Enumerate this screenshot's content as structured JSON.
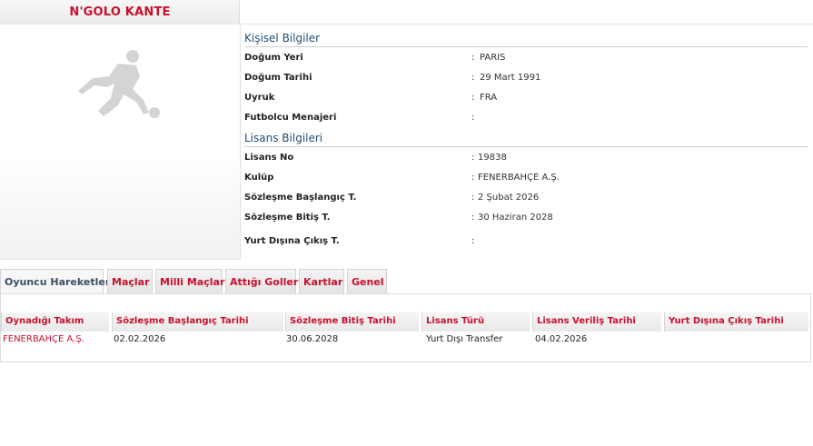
{
  "player": {
    "name": "N'GOLO KANTE"
  },
  "personal": {
    "title": "Kişisel Bilgiler",
    "rows": [
      {
        "label": "Doğum Yeri",
        "value": "PARIS"
      },
      {
        "label": "Doğum Tarihi",
        "value": "29 Mart 1991"
      },
      {
        "label": "Uyruk",
        "value": "FRA"
      },
      {
        "label": "Futbolcu Menajeri",
        "value": ""
      }
    ]
  },
  "license": {
    "title": "Lisans Bilgileri",
    "rows": [
      {
        "label": "Lisans No",
        "value": "19838"
      },
      {
        "label": "Kulüp",
        "value": "FENERBAHÇE A.Ş."
      },
      {
        "label": "Sözleşme Başlangıç T.",
        "value": "2 Şubat 2026"
      },
      {
        "label": "Sözleşme Bitiş T.",
        "value": "30 Haziran 2028"
      },
      {
        "label": "Yurt Dışına Çıkış T.",
        "value": ""
      }
    ]
  },
  "tabs": [
    {
      "label": "Oyuncu Hareketleri",
      "active": true
    },
    {
      "label": "Maçlar"
    },
    {
      "label": "Milli Maçlar"
    },
    {
      "label": "Attığı Goller"
    },
    {
      "label": "Kartlar"
    },
    {
      "label": "Genel"
    }
  ],
  "movements": {
    "headers": [
      "Oynadığı Takım",
      "Sözleşme Başlangıç Tarihi",
      "Sözleşme Bitiş Tarihi",
      "Lisans Türü",
      "Lisans Veriliş Tarihi",
      "Yurt Dışına Çıkış Tarihi"
    ],
    "rows": [
      [
        "FENERBAHÇE A.Ş.",
        "02.02.2026",
        "30.06.2028",
        "Yurt Dışı Transfer",
        "04.02.2026",
        ""
      ]
    ]
  },
  "icons": {
    "player_photo": "footballer-silhouette-icon"
  },
  "colors": {
    "accent_red": "#c8102e",
    "section_blue": "#1f4e79"
  }
}
